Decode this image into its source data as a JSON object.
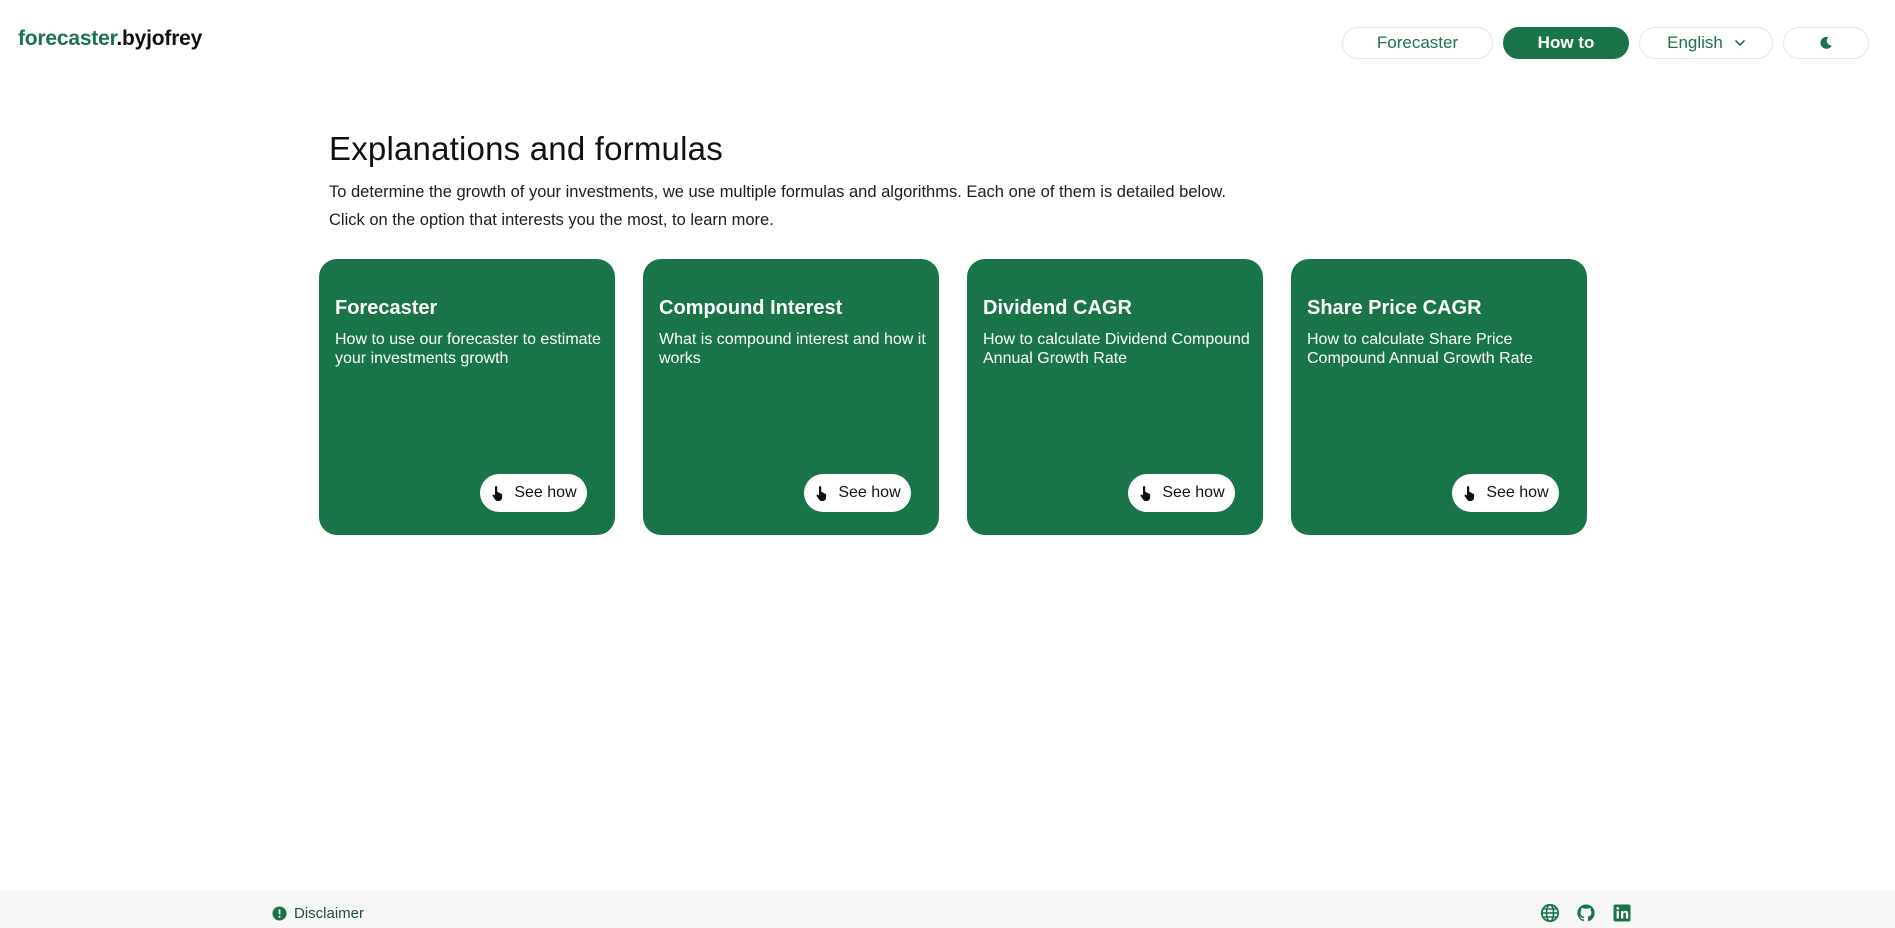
{
  "header": {
    "logo_brand": "forecaster",
    "logo_by": ".byjofrey",
    "nav": {
      "forecaster": "Forecaster",
      "howto": "How to",
      "language": "English"
    }
  },
  "main": {
    "title": "Explanations and formulas",
    "desc_line1": "To determine the growth of your investments, we use multiple formulas and algorithms. Each one of them is detailed below.",
    "desc_line2": "Click on the option that interests you the most, to learn more.",
    "cards": [
      {
        "title": "Forecaster",
        "desc": "How to use our forecaster to estimate your investments growth",
        "button": "See how"
      },
      {
        "title": "Compound Interest",
        "desc": "What is compound interest and how it works",
        "button": "See how"
      },
      {
        "title": "Dividend CAGR",
        "desc": "How to calculate Dividend Compound Annual Growth Rate",
        "button": "See how"
      },
      {
        "title": "Share Price CAGR",
        "desc": "How to calculate Share Price Compound Annual Growth Rate",
        "button": "See how"
      }
    ]
  },
  "footer": {
    "disclaimer": "Disclaimer",
    "icons": [
      "globe-icon",
      "github-icon",
      "linkedin-icon"
    ]
  },
  "colors": {
    "accent": "#1a744a",
    "background": "#ffffff",
    "footer_bg": "#f6f7f6"
  }
}
